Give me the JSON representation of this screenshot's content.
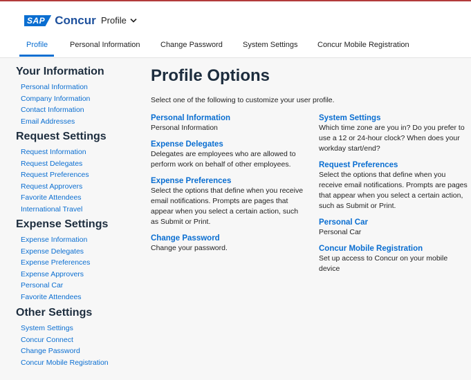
{
  "brand": {
    "sap": "SAP",
    "name": "Concur"
  },
  "header": {
    "profile_menu": "Profile"
  },
  "nav": {
    "tabs": [
      {
        "label": "Profile",
        "active": true
      },
      {
        "label": "Personal Information"
      },
      {
        "label": "Change Password"
      },
      {
        "label": "System Settings"
      },
      {
        "label": "Concur Mobile Registration"
      }
    ]
  },
  "sidebar": {
    "sections": [
      {
        "title": "Your Information",
        "items": [
          "Personal Information",
          "Company Information",
          "Contact Information",
          "Email Addresses"
        ]
      },
      {
        "title": "Request Settings",
        "items": [
          "Request Information",
          "Request Delegates",
          "Request Preferences",
          "Request Approvers",
          "Favorite Attendees",
          "International Travel"
        ]
      },
      {
        "title": "Expense Settings",
        "items": [
          "Expense Information",
          "Expense Delegates",
          "Expense Preferences",
          "Expense Approvers",
          "Personal Car",
          "Favorite Attendees"
        ]
      },
      {
        "title": "Other Settings",
        "items": [
          "System Settings",
          "Concur Connect",
          "Change Password",
          "Concur Mobile Registration"
        ]
      }
    ]
  },
  "main": {
    "title": "Profile Options",
    "intro": "Select one of the following to customize your user profile.",
    "left_options": [
      {
        "title": "Personal Information",
        "desc": "Personal Information"
      },
      {
        "title": "Expense Delegates",
        "desc": "Delegates are employees who are allowed to perform work on behalf of other employees."
      },
      {
        "title": "Expense Preferences",
        "desc": "Select the options that define when you receive email notifications. Prompts are pages that appear when you select a certain action, such as Submit or Print."
      },
      {
        "title": "Change Password",
        "desc": "Change your password."
      }
    ],
    "right_options": [
      {
        "title": "System Settings",
        "desc": "Which time zone are you in? Do you prefer to use a 12 or 24-hour clock? When does your workday start/end?"
      },
      {
        "title": "Request Preferences",
        "desc": "Select the options that define when you receive email notifications. Prompts are pages that appear when you select a certain action, such as Submit or Print."
      },
      {
        "title": "Personal Car",
        "desc": "Personal Car"
      },
      {
        "title": "Concur Mobile Registration",
        "desc": "Set up access to Concur on your mobile device"
      }
    ]
  },
  "colors": {
    "accent": "#0a6ed1",
    "heading": "#1d2d3e",
    "background": "#f7f7f7"
  }
}
